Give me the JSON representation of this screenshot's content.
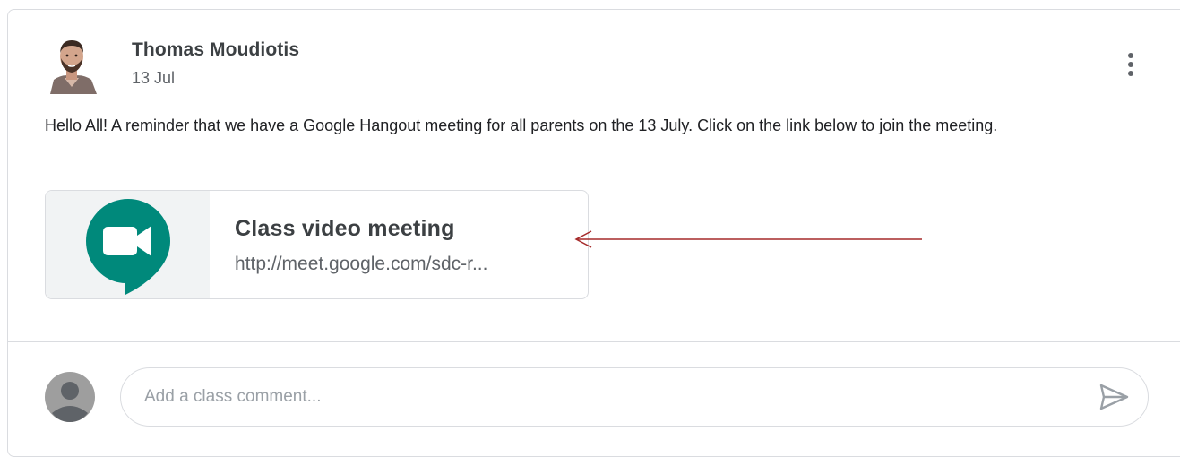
{
  "post": {
    "author": "Thomas Moudiotis",
    "date": "13 Jul",
    "body": "Hello All! A reminder that we have a Google Hangout meeting for all parents on the 13 July. Click on the link below to join the meeting.",
    "author_avatar_icon": "author-profile-photo",
    "menu_icon": "more-vert-icon"
  },
  "attachment": {
    "title": "Class video meeting",
    "url": "http://meet.google.com/sdc-r...",
    "icon": "google-meet-logo",
    "logo_colors": {
      "green": "#00897b",
      "white": "#ffffff"
    }
  },
  "annotation": {
    "arrow_color": "#a52a2a"
  },
  "comment": {
    "placeholder": "Add a class comment...",
    "value": "",
    "avatar_icon": "default-user-avatar",
    "send_icon": "send-icon"
  }
}
